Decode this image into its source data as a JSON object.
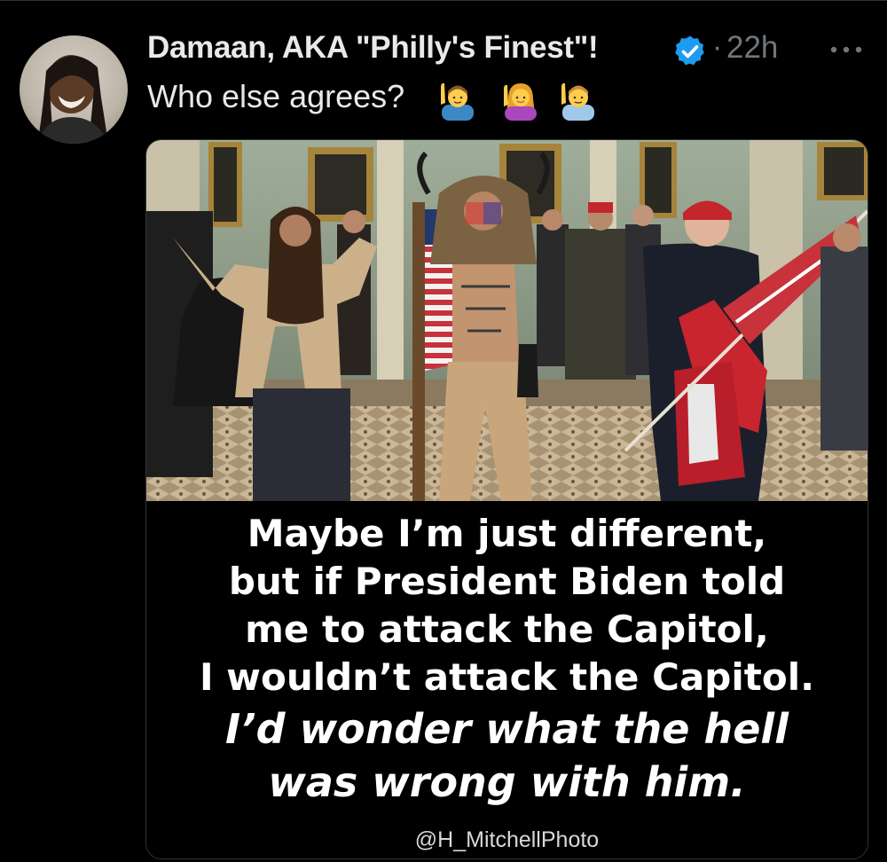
{
  "post": {
    "author_name": "Damaan, AKA \"Philly's Finest\"!",
    "separator": "·",
    "timestamp": "22h",
    "text": "Who else agrees?",
    "emojis": [
      "man-raising-hand-icon",
      "woman-raising-hand-icon",
      "man-raising-hand-icon"
    ],
    "verified_color": "#1d9bf0"
  },
  "meme": {
    "lines": [
      "Maybe I’m just different,",
      "but if President Biden told",
      "me to attack the Capitol,",
      "I wouldn’t attack the Capitol.",
      "I’d wonder what the hell",
      "was wrong with him."
    ],
    "credit": "@H_MitchellPhoto"
  }
}
